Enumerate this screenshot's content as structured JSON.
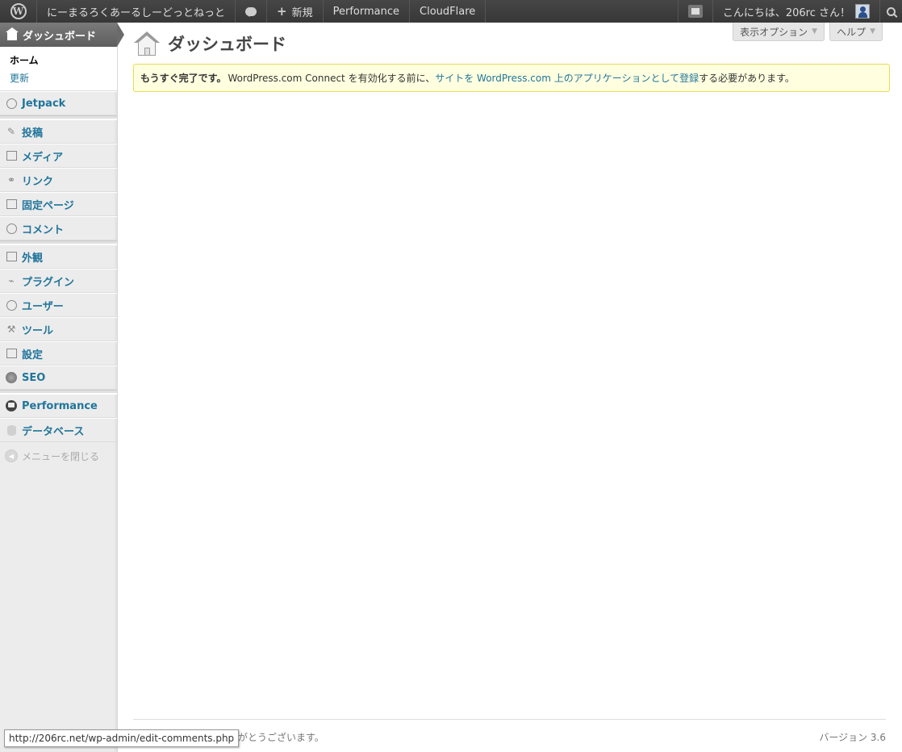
{
  "adminbar": {
    "site_name": "にーまるろくあーるしーどっとねっと",
    "new_label": "新規",
    "performance": "Performance",
    "cloudflare": "CloudFlare",
    "greeting": "こんにちは、206rc さん！"
  },
  "sidebar": {
    "current": "ダッシュボード",
    "submenu": {
      "home": "ホーム",
      "updates": "更新"
    },
    "items": {
      "jetpack": "Jetpack",
      "posts": "投稿",
      "media": "メディア",
      "links": "リンク",
      "pages": "固定ページ",
      "comments": "コメント",
      "appearance": "外観",
      "plugins": "プラグイン",
      "users": "ユーザー",
      "tools": "ツール",
      "settings": "設定",
      "seo": "SEO",
      "performance": "Performance",
      "database": "データベース"
    },
    "collapse": "メニューを閉じる"
  },
  "screen_meta": {
    "options": "表示オプション",
    "help": "ヘルプ"
  },
  "page": {
    "title": "ダッシュボード"
  },
  "notice": {
    "strong": "もうすぐ完了です。",
    "text_before": "WordPress.com Connect を有効化する前に、",
    "link": "サイトを WordPress.com 上のアプリケーションとして登録",
    "text_after": "する必要があります。"
  },
  "footer": {
    "thanks": "がとうございます。",
    "version": "バージョン 3.6"
  },
  "statusbar": {
    "url": "http://206rc.net/wp-admin/edit-comments.php"
  }
}
